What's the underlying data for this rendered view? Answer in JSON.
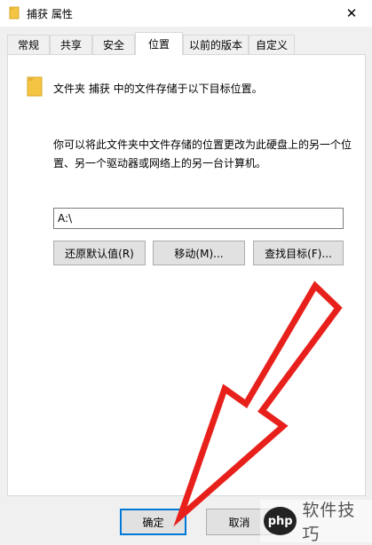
{
  "window": {
    "title": "捕获 属性",
    "close_glyph": "✕"
  },
  "tabs": [
    {
      "label": "常规"
    },
    {
      "label": "共享"
    },
    {
      "label": "安全"
    },
    {
      "label": "位置",
      "active": true
    },
    {
      "label": "以前的版本"
    },
    {
      "label": "自定义"
    }
  ],
  "location": {
    "heading": "文件夹 捕获 中的文件存储于以下目标位置。",
    "description": "你可以将此文件夹中文件存储的位置更改为此硬盘上的另一个位置、另一个驱动器或网络上的另一台计算机。",
    "path_value": "A:\\",
    "buttons": {
      "restore_default": "还原默认值(R)",
      "move": "移动(M)...",
      "find_target": "查找目标(F)..."
    }
  },
  "footer": {
    "ok": "确定",
    "cancel": "取消"
  },
  "watermark": {
    "logo": "php",
    "text": "软件技巧"
  },
  "colors": {
    "accent": "#0078d7",
    "arrow": "#e8201c",
    "folder": "#f4c542"
  }
}
